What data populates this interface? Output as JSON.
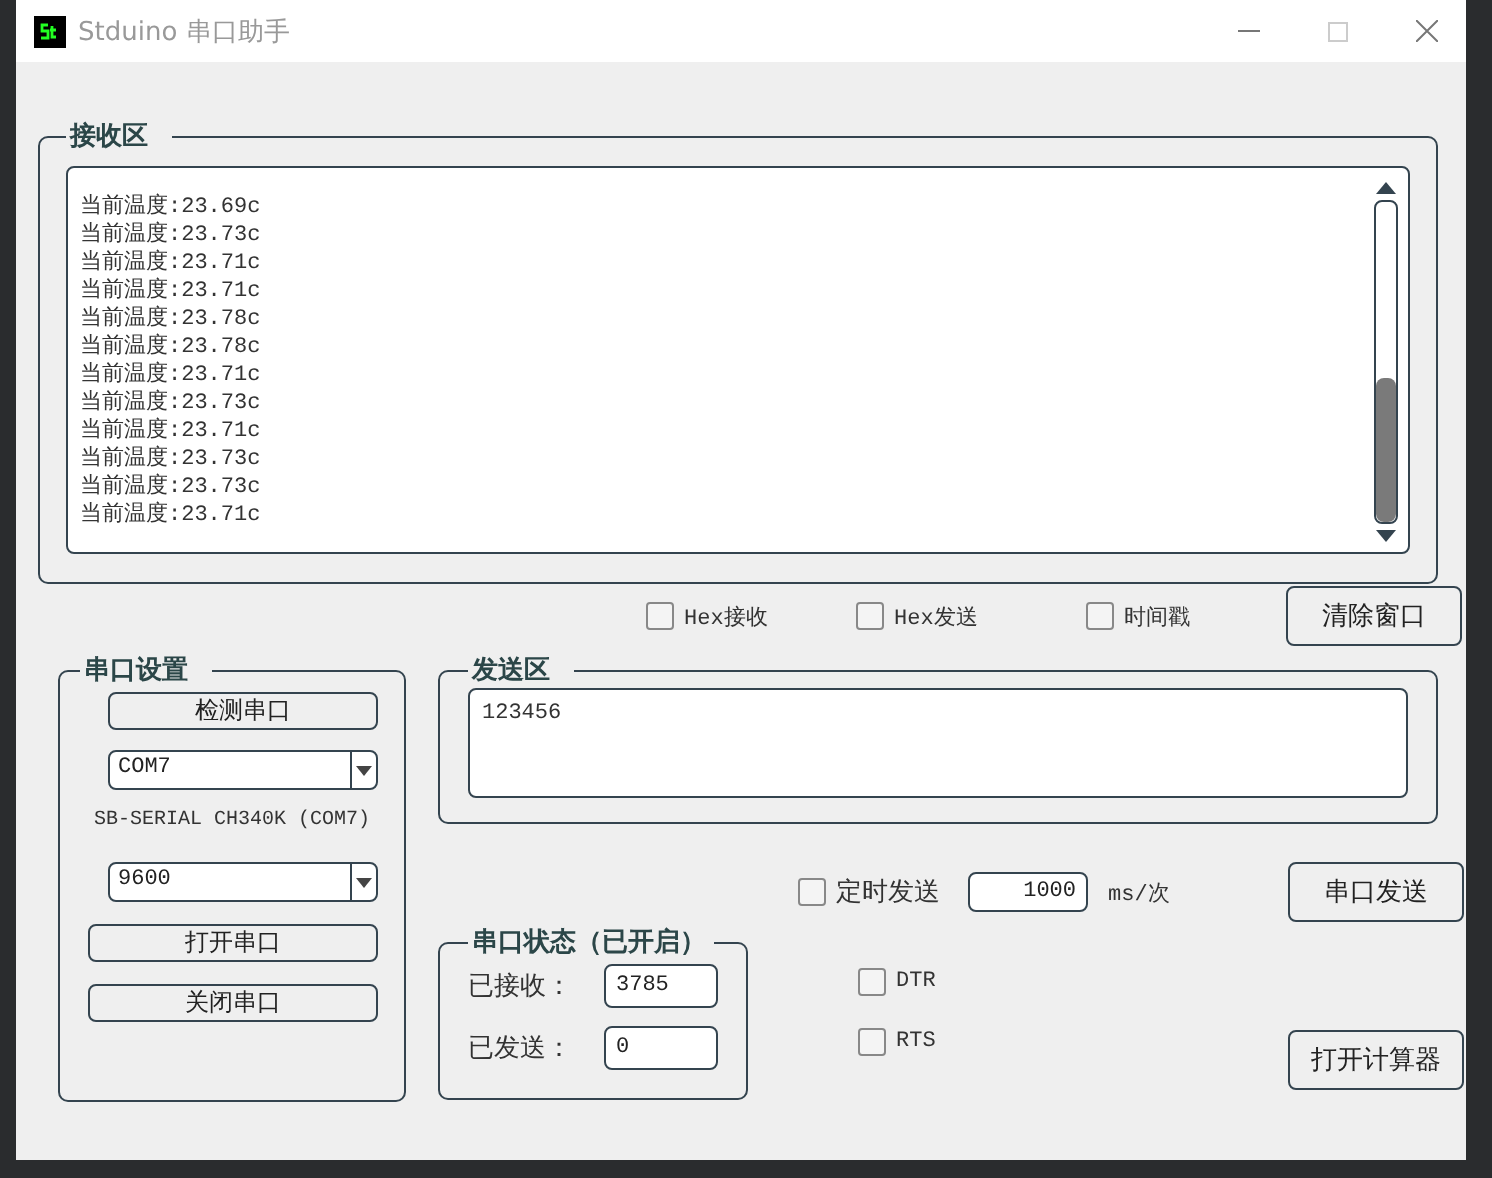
{
  "window": {
    "title": "Stduino 串口助手"
  },
  "receive_area": {
    "title": "接收区",
    "lines": [
      "当前温度:23.69c",
      "当前温度:23.73c",
      "当前温度:23.71c",
      "当前温度:23.71c",
      "当前温度:23.78c",
      "当前温度:23.78c",
      "当前温度:23.71c",
      "当前温度:23.73c",
      "当前温度:23.71c",
      "当前温度:23.73c",
      "当前温度:23.73c",
      "当前温度:23.71c"
    ]
  },
  "options": [
    {
      "label": "Hex接收",
      "checked": false
    },
    {
      "label": "Hex发送",
      "checked": false
    },
    {
      "label": "时间戳",
      "checked": false
    }
  ],
  "clear_button": "清除窗口",
  "port_settings": {
    "title": "串口设置",
    "detect_button": "检测串口",
    "port": "COM7",
    "port_description": "SB-SERIAL CH340K (COM7)",
    "baud_rate": "9600",
    "open_button": "打开串口",
    "close_button": "关闭串口"
  },
  "send_area": {
    "title": "发送区",
    "value": "123456"
  },
  "timed_send": {
    "label": "定时发送",
    "checked": false,
    "interval": "1000",
    "unit": "ms/次"
  },
  "send_button": "串口发送",
  "port_status": {
    "title": "串口状态（已开启）",
    "fields": [
      {
        "label": "已接收：",
        "value": "3785"
      },
      {
        "label": "已发送：",
        "value": "0"
      }
    ]
  },
  "signals": [
    {
      "label": "DTR",
      "checked": false
    },
    {
      "label": "RTS",
      "checked": false
    }
  ],
  "calculator_button": "打开计算器"
}
